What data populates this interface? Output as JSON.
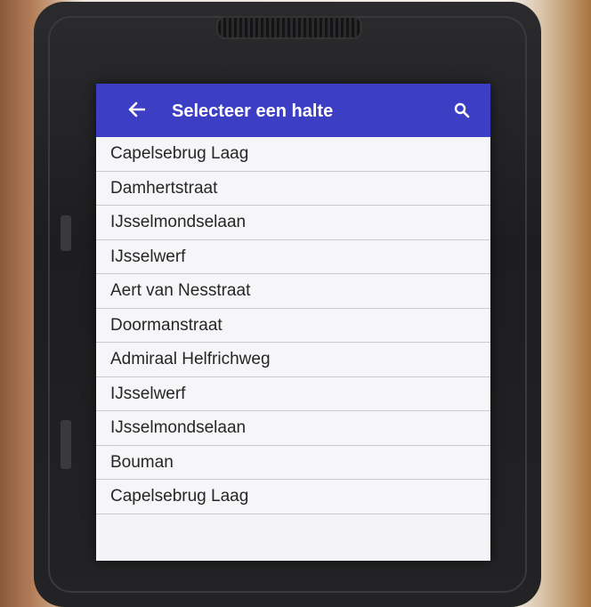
{
  "header": {
    "title": "Selecteer een halte",
    "back_icon": "arrow-left-icon",
    "search_icon": "search-icon",
    "color": "#3c3fc4"
  },
  "stops": [
    "Capelsebrug Laag",
    "Damhertstraat",
    "IJsselmondselaan",
    "IJsselwerf",
    "Aert van Nesstraat",
    "Doormanstraat",
    "Admiraal Helfrichweg",
    "IJsselwerf",
    "IJsselmondselaan",
    "Bouman",
    "Capelsebrug Laag"
  ]
}
